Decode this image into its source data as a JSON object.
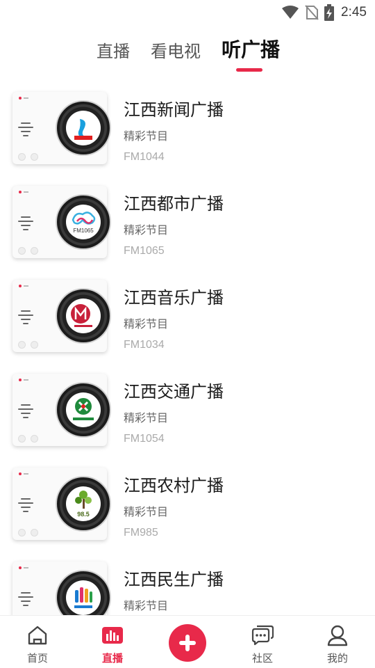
{
  "status_bar": {
    "time": "2:45",
    "icons": [
      "wifi-icon",
      "no-sim-icon",
      "battery-charging-icon"
    ]
  },
  "tabs": [
    {
      "label": "直播",
      "active": false
    },
    {
      "label": "看电视",
      "active": false
    },
    {
      "label": "听广播",
      "active": true
    }
  ],
  "accent_color": "#e8294a",
  "stations": [
    {
      "name": "江西新闻广播",
      "subtitle": "精彩节目",
      "frequency": "FM1044",
      "logo_icon": "jiangxi-news-radio-logo"
    },
    {
      "name": "江西都市广播",
      "subtitle": "精彩节目",
      "frequency": "FM1065",
      "logo_icon": "jiangxi-city-radio-logo",
      "logo_text": "FM1065"
    },
    {
      "name": "江西音乐广播",
      "subtitle": "精彩节目",
      "frequency": "FM1034",
      "logo_icon": "jiangxi-music-radio-logo"
    },
    {
      "name": "江西交通广播",
      "subtitle": "精彩节目",
      "frequency": "FM1054",
      "logo_icon": "jiangxi-traffic-radio-logo"
    },
    {
      "name": "江西农村广播",
      "subtitle": "精彩节目",
      "frequency": "FM985",
      "logo_icon": "jiangxi-rural-radio-logo",
      "logo_text": "98.5"
    },
    {
      "name": "江西民生广播",
      "subtitle": "精彩节目",
      "frequency": "",
      "logo_icon": "jiangxi-livelihood-radio-logo"
    }
  ],
  "bottom_nav": [
    {
      "label": "首页",
      "icon": "home-icon",
      "active": false
    },
    {
      "label": "直播",
      "icon": "live-bars-icon",
      "active": true
    },
    {
      "label": "",
      "icon": "plus-icon",
      "active": false
    },
    {
      "label": "社区",
      "icon": "chat-bubbles-icon",
      "active": false
    },
    {
      "label": "我的",
      "icon": "user-icon",
      "active": false
    }
  ]
}
